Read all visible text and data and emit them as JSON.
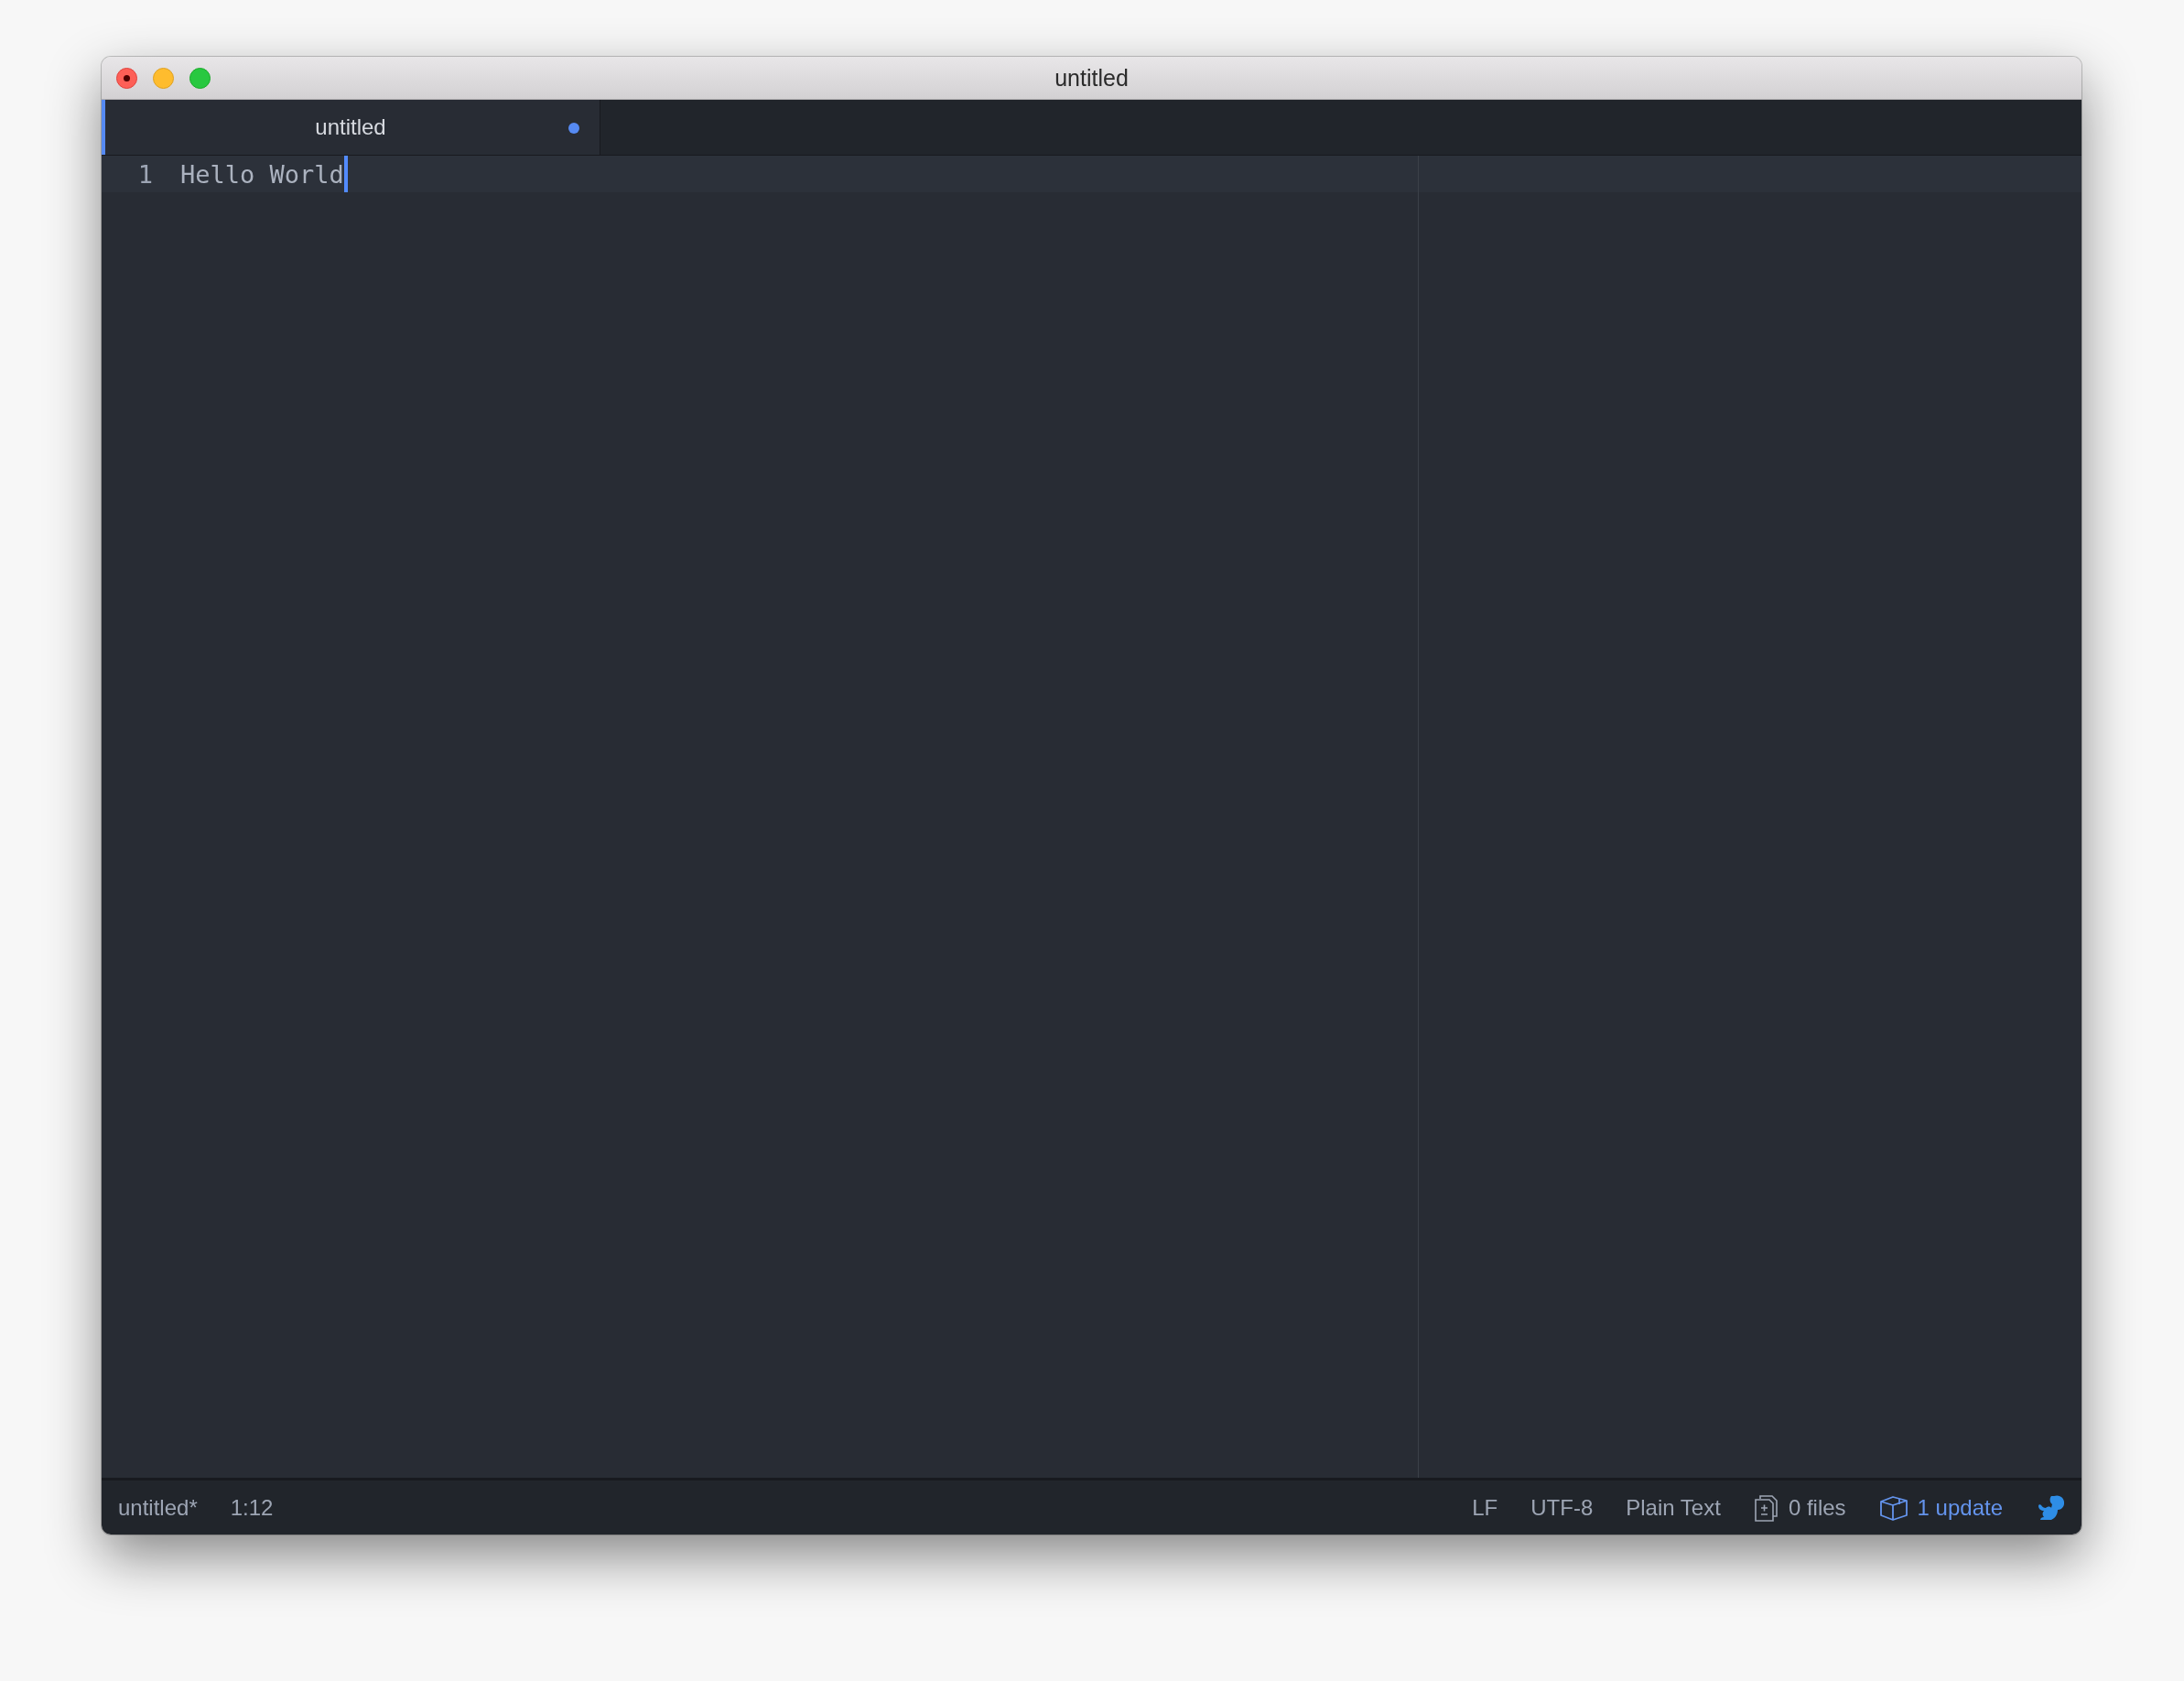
{
  "window": {
    "title": "untitled"
  },
  "tabs": [
    {
      "label": "untitled",
      "selected": true,
      "modified": true
    }
  ],
  "editor": {
    "lines": [
      {
        "number": "1",
        "text": "Hello World",
        "current": true
      }
    ]
  },
  "status_bar": {
    "left": [
      {
        "kind": "text",
        "text": "untitled*"
      },
      {
        "kind": "text",
        "text": "1:12"
      }
    ],
    "right": [
      {
        "kind": "text",
        "text": "LF"
      },
      {
        "kind": "text",
        "text": "UTF-8"
      },
      {
        "kind": "text",
        "text": "Plain Text"
      },
      {
        "kind": "files",
        "text": "0 files"
      },
      {
        "kind": "update",
        "text": "1 update"
      },
      {
        "kind": "squirrel"
      }
    ]
  }
}
